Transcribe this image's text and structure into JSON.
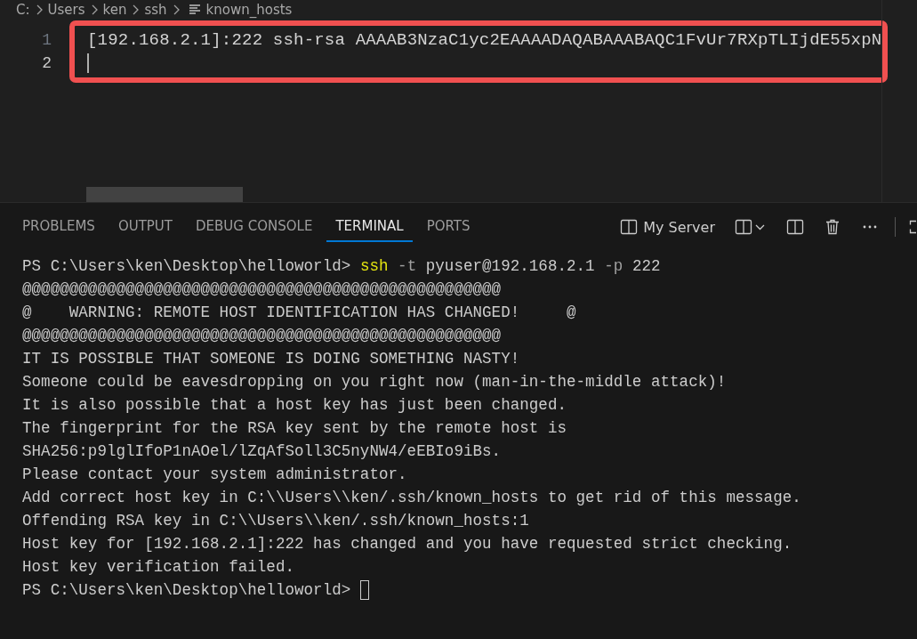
{
  "breadcrumb": [
    {
      "label": "C:",
      "kind": "folder"
    },
    {
      "label": "Users",
      "kind": "folder"
    },
    {
      "label": "ken",
      "kind": "folder"
    },
    {
      "label": "ssh",
      "kind": "folder"
    },
    {
      "label": "known_hosts",
      "kind": "file"
    }
  ],
  "editor": {
    "lines": [
      {
        "number": "1",
        "text": "[192.168.2.1]:222 ssh-rsa AAAAB3NzaC1yc2EAAAADAQABAAABAQC1FvUr7RXpTLIjdE55xpN",
        "current": false
      },
      {
        "number": "2",
        "current": true
      }
    ]
  },
  "panel": {
    "tabs": [
      {
        "label": "PROBLEMS",
        "selected": false
      },
      {
        "label": "OUTPUT",
        "selected": false
      },
      {
        "label": "DEBUG CONSOLE",
        "selected": false
      },
      {
        "label": "TERMINAL",
        "selected": true
      },
      {
        "label": "PORTS",
        "selected": false
      }
    ],
    "terminal_name": "My Server"
  },
  "terminal": {
    "lines": [
      [
        {
          "kind": "prompt",
          "text": "PS C:\\Users\\ken\\Desktop\\helloworld> "
        },
        {
          "kind": "command",
          "text": "ssh"
        },
        {
          "kind": "flag",
          "text": " -t"
        },
        {
          "kind": "arg",
          "text": " pyuser@192.168.2.1"
        },
        {
          "kind": "flag",
          "text": " -p"
        },
        {
          "kind": "arg",
          "text": " 222"
        }
      ],
      [
        {
          "kind": "output",
          "text": "@@@@@@@@@@@@@@@@@@@@@@@@@@@@@@@@@@@@@@@@@@@@@@@@@@@"
        }
      ],
      [
        {
          "kind": "output",
          "text": "@    WARNING: REMOTE HOST IDENTIFICATION HAS CHANGED!     @"
        }
      ],
      [
        {
          "kind": "output",
          "text": "@@@@@@@@@@@@@@@@@@@@@@@@@@@@@@@@@@@@@@@@@@@@@@@@@@@"
        }
      ],
      [
        {
          "kind": "output",
          "text": "IT IS POSSIBLE THAT SOMEONE IS DOING SOMETHING NASTY!"
        }
      ],
      [
        {
          "kind": "output",
          "text": "Someone could be eavesdropping on you right now (man-in-the-middle attack)!"
        }
      ],
      [
        {
          "kind": "output",
          "text": "It is also possible that a host key has just been changed."
        }
      ],
      [
        {
          "kind": "output",
          "text": "The fingerprint for the RSA key sent by the remote host is"
        }
      ],
      [
        {
          "kind": "output",
          "text": "SHA256:p9lglIfoP1nAOel/lZqAfSoll3C5nyNW4/eEBIo9iBs."
        }
      ],
      [
        {
          "kind": "output",
          "text": "Please contact your system administrator."
        }
      ],
      [
        {
          "kind": "output",
          "text": "Add correct host key in C:\\\\Users\\\\ken/.ssh/known_hosts to get rid of this message."
        }
      ],
      [
        {
          "kind": "output",
          "text": "Offending RSA key in C:\\\\Users\\\\ken/.ssh/known_hosts:1"
        }
      ],
      [
        {
          "kind": "output",
          "text": "Host key for [192.168.2.1]:222 has changed and you have requested strict checking."
        }
      ],
      [
        {
          "kind": "output",
          "text": "Host key verification failed."
        }
      ],
      [
        {
          "kind": "prompt",
          "text": "PS C:\\Users\\ken\\Desktop\\helloworld> "
        }
      ]
    ],
    "cursor": true
  }
}
